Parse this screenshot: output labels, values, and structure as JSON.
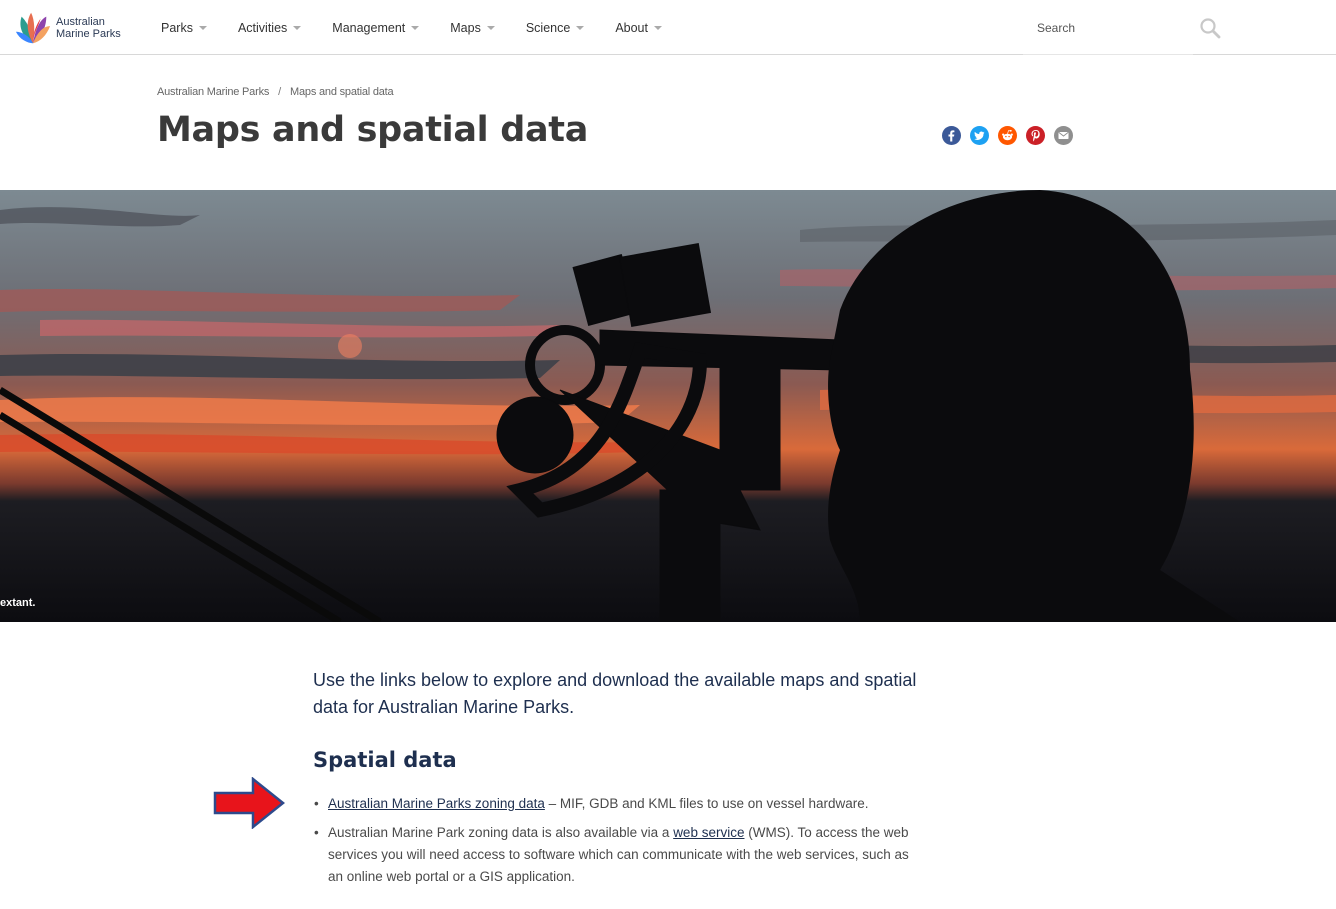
{
  "header": {
    "logo_line1": "Australian",
    "logo_line2": "Marine Parks",
    "nav": [
      {
        "label": "Parks"
      },
      {
        "label": "Activities"
      },
      {
        "label": "Management"
      },
      {
        "label": "Maps"
      },
      {
        "label": "Science"
      },
      {
        "label": "About"
      }
    ],
    "search": {
      "placeholder": "Search",
      "value": ""
    }
  },
  "breadcrumb": {
    "items": [
      "Australian Marine Parks",
      "Maps and spatial data"
    ],
    "separator": "/"
  },
  "page_title": "Maps and spatial data",
  "share": {
    "icons": [
      "facebook-icon",
      "twitter-icon",
      "reddit-icon",
      "pinterest-icon",
      "email-icon"
    ],
    "colors": {
      "facebook": "#3b5998",
      "twitter": "#1da1f2",
      "reddit": "#ff5700",
      "pinterest": "#cb2027",
      "email": "#8f8f8f"
    }
  },
  "hero": {
    "caption": "extant."
  },
  "intro": "Use the links below to explore and download the available maps and spatial data for Australian Marine Parks.",
  "spatial_data": {
    "heading": "Spatial data",
    "items": [
      {
        "bullet": "•",
        "link": "Australian Marine Parks zoning data",
        "text": " – MIF, GDB and KML files to use on vessel hardware."
      },
      {
        "bullet": "•",
        "text_before": "Australian Marine Park zoning data is also available via a ",
        "link": "web service",
        "text_after": " (WMS). To access the web services you will need access to software which can communicate with the web services, such as an online web portal or a GIS application."
      }
    ]
  },
  "colors": {
    "heading": "#1e2f4f",
    "arrow_fill": "#e8141b",
    "arrow_stroke": "#2e4a8c"
  }
}
